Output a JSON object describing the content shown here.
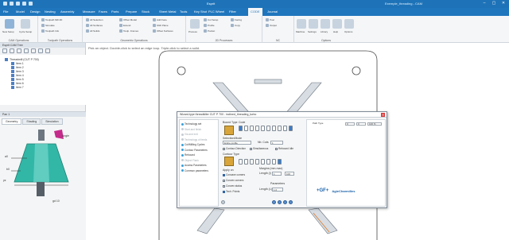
{
  "window": {
    "title": "Esprit",
    "document": "Exemple_threading - CAM"
  },
  "menu": {
    "tabs": [
      "File",
      "Model",
      "Design",
      "Nesting",
      "Assembly",
      "Measure",
      "Faces",
      "Parts",
      "Prepare",
      "Stock",
      "Sheet Metal",
      "Tools",
      "Key Shot",
      "PLC Wheel",
      "Filter",
      "CODE",
      "Journal"
    ],
    "active_tab": "CODE"
  },
  "ribbon": {
    "groups": [
      {
        "label": "CAM Operations",
        "buttons": [
          "New Setup",
          "Cycle Setup"
        ]
      },
      {
        "label": "Toolpath Operations",
        "buttons": [
          "Toolpath Mill 2D",
          "Simulate",
          "Toolpath Info"
        ]
      },
      {
        "label": "Geometric Operations",
        "buttons": [
          "All Selection",
          "All Surfaces",
          "All Solids",
          "Offset Model",
          "Extend",
          "Toolp. Frames",
          "Add Face",
          "Shift Plane",
          "Offset Surfaces"
        ]
      },
      {
        "label": "2D Processes",
        "buttons": [
          "Process",
          "Cut Setup",
          "Profile",
          "Pocket",
          "Facing",
          "Copy"
        ]
      },
      {
        "label": "NC",
        "buttons": [
          "Post",
          "Output"
        ]
      },
      {
        "label": "Options",
        "buttons": [
          "Machine",
          "Settings",
          "Library",
          "Help",
          "Options"
        ]
      }
    ]
  },
  "left_panel": {
    "tree_title": "Esprit CAM Tree",
    "tree": [
      "Threadmill (CUT P 700)",
      "Item 1",
      "Item 2",
      "Item 3",
      "Item 4",
      "Item 5",
      "Item 6",
      "Item 7"
    ],
    "props_title": "Pan 1",
    "tabs": [
      "Geometry",
      "Shading",
      "Simulation"
    ],
    "figure_labels": [
      "Angle",
      "a0",
      "b0",
      "yz",
      "gd 10"
    ]
  },
  "canvas": {
    "hint": "Pick an object. Double-click to select an edge loop. Triple-click to select a solid."
  },
  "dialog": {
    "title": "Wizard-type threadkiller CUT P 700 - inclined_threading_turbo",
    "close_symbol": "✕",
    "nav": [
      {
        "label": "Technology set",
        "active": true
      },
      {
        "label": "Start and finish",
        "active": false
      },
      {
        "label": "Via and exit",
        "active": false
      },
      {
        "label": "Technology of feeds",
        "active": false
      },
      {
        "label": "Cut/Milling Cycles",
        "active": true
      },
      {
        "label": "Contour Parameters",
        "active": true
      },
      {
        "label": "Rebound",
        "active": true
      },
      {
        "label": "Object Flank",
        "active": false
      },
      {
        "label": "Access Parameters",
        "active": true
      },
      {
        "label": "Common parameters",
        "active": true
      }
    ],
    "bound_type_label": "Bound Type",
    "code_label": "Code",
    "select_label": "Selection/Mode",
    "select_value": "Entire profile",
    "number_label": "Nb. Cuts",
    "number_value": "1",
    "checks_row": [
      "Contour-Direction",
      "Simultaneous",
      "Rebound Idle"
    ],
    "contour_type_label": "Contour Type",
    "apply_on_label": "Apply on",
    "margins_label": "Margins (mm-max)",
    "length_label": "Length (l)",
    "length_value": "1",
    "length_max": "100",
    "options": [
      {
        "label": "Concave corners",
        "checked": true
      },
      {
        "label": "Convex corners",
        "checked": false
      },
      {
        "label": "Convex status",
        "checked": false
      },
      {
        "label": "Tech. Points",
        "checked": true
      }
    ],
    "parameters_label": "Parameters",
    "param_field_label": "Length (L)",
    "param_field_value": "1.0",
    "right_fields": [
      "Path Type",
      "0",
      "0",
      "100 %"
    ],
    "brand_logo": "+GF+",
    "brand_name": "AgieCharmilles"
  }
}
